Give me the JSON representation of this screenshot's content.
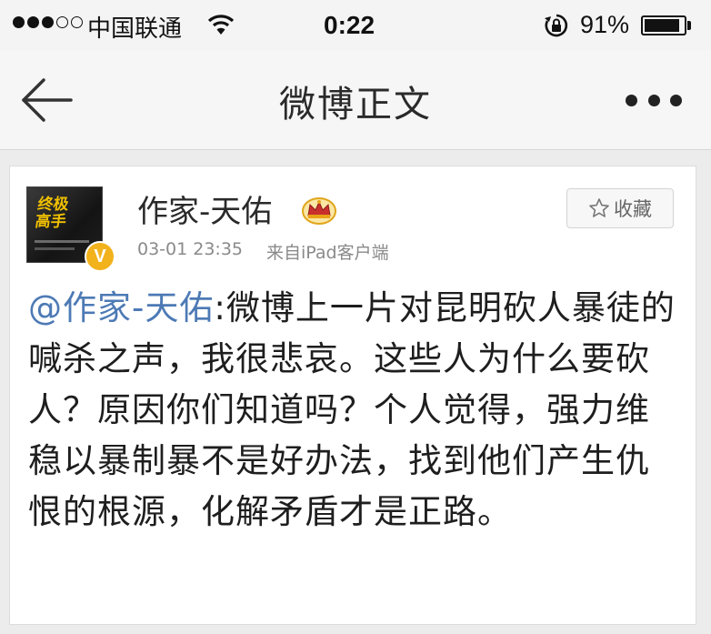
{
  "status_bar": {
    "carrier": "中国联通",
    "time": "0:22",
    "battery_percent": "91%",
    "battery_level": 0.91,
    "signal_bars_filled": 3,
    "signal_bars_total": 5
  },
  "nav": {
    "title": "微博正文",
    "back_icon": "arrow-left-icon",
    "more_icon": "more-dots-icon"
  },
  "post": {
    "author": "作家-天佑",
    "author_badge": "crown-icon",
    "verified_mark": "V",
    "time": "03-01 23:35",
    "source": "来自iPad客户端",
    "favorite_label": "收藏",
    "avatar_text": "终极\n高手",
    "mention": "@作家-天佑",
    "body": ":微博上一片对昆明砍人暴徒的喊杀之声，我很悲哀。这些人为什么要砍人？原因你们知道吗？个人觉得，强力维稳以暴制暴不是好办法，找到他们产生仇恨的根源，化解矛盾才是正路。"
  },
  "colors": {
    "mention": "#4d7ab5",
    "verified_badge": "#f2b21c",
    "meta_text": "#8a8a8a"
  }
}
